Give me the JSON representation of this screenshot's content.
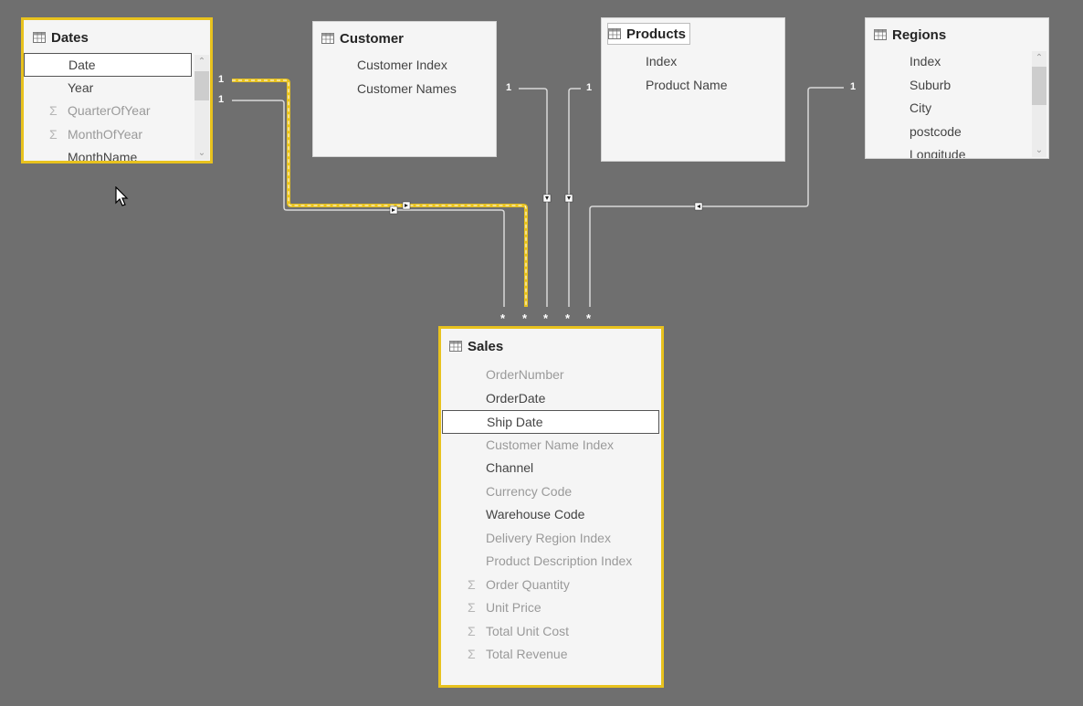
{
  "tables": {
    "dates": {
      "title": "Dates",
      "fields": [
        {
          "name": "Date",
          "aggregate": false,
          "hidden": false,
          "highlighted": true
        },
        {
          "name": "Year",
          "aggregate": false,
          "hidden": false
        },
        {
          "name": "QuarterOfYear",
          "aggregate": true,
          "hidden": true
        },
        {
          "name": "MonthOfYear",
          "aggregate": true,
          "hidden": true
        },
        {
          "name": "MonthName",
          "aggregate": false,
          "hidden": false
        }
      ],
      "selected": true
    },
    "customer": {
      "title": "Customer",
      "fields": [
        {
          "name": "Customer Index",
          "aggregate": false,
          "hidden": false
        },
        {
          "name": "Customer Names",
          "aggregate": false,
          "hidden": false
        }
      ]
    },
    "products": {
      "title": "Products",
      "fields": [
        {
          "name": "Index",
          "aggregate": false,
          "hidden": false
        },
        {
          "name": "Product Name",
          "aggregate": false,
          "hidden": false
        }
      ]
    },
    "regions": {
      "title": "Regions",
      "fields": [
        {
          "name": "Index",
          "aggregate": false,
          "hidden": false
        },
        {
          "name": "Suburb",
          "aggregate": false,
          "hidden": false
        },
        {
          "name": "City",
          "aggregate": false,
          "hidden": false
        },
        {
          "name": "postcode",
          "aggregate": false,
          "hidden": false
        },
        {
          "name": "Longitude",
          "aggregate": false,
          "hidden": false
        }
      ]
    },
    "sales": {
      "title": "Sales",
      "selected": true,
      "fields": [
        {
          "name": "OrderNumber",
          "aggregate": false,
          "hidden": true
        },
        {
          "name": "OrderDate",
          "aggregate": false,
          "hidden": false
        },
        {
          "name": "Ship Date",
          "aggregate": false,
          "hidden": false,
          "highlighted": true
        },
        {
          "name": "Customer Name Index",
          "aggregate": false,
          "hidden": true
        },
        {
          "name": "Channel",
          "aggregate": false,
          "hidden": false
        },
        {
          "name": "Currency Code",
          "aggregate": false,
          "hidden": true
        },
        {
          "name": "Warehouse Code",
          "aggregate": false,
          "hidden": false
        },
        {
          "name": "Delivery Region Index",
          "aggregate": false,
          "hidden": true
        },
        {
          "name": "Product Description Index",
          "aggregate": false,
          "hidden": true
        },
        {
          "name": "Order Quantity",
          "aggregate": true,
          "hidden": true
        },
        {
          "name": "Unit Price",
          "aggregate": true,
          "hidden": true
        },
        {
          "name": "Total Unit Cost",
          "aggregate": true,
          "hidden": true
        },
        {
          "name": "Total Revenue",
          "aggregate": true,
          "hidden": true
        }
      ]
    }
  },
  "relationships": [
    {
      "from": "Dates",
      "to": "Sales",
      "one_label": "1",
      "many_label": "*",
      "active": true,
      "highlighted": true
    },
    {
      "from": "Dates",
      "to": "Sales",
      "one_label": "1",
      "many_label": "*",
      "active": true,
      "highlighted": false
    },
    {
      "from": "Customer",
      "to": "Sales",
      "one_label": "1",
      "many_label": "*",
      "active": true
    },
    {
      "from": "Products",
      "to": "Sales",
      "one_label": "1",
      "many_label": "*",
      "active": true
    },
    {
      "from": "Regions",
      "to": "Sales",
      "one_label": "1",
      "many_label": "*",
      "active": true
    }
  ],
  "labels": {
    "one": "1",
    "many": "*",
    "sigma": "Σ",
    "scroll_up": "^",
    "scroll_down": "v"
  },
  "colors": {
    "canvas": "#6f6f6f",
    "highlight": "#e8c21e",
    "line": "#d8d8d8",
    "card": "#f5f5f5"
  }
}
